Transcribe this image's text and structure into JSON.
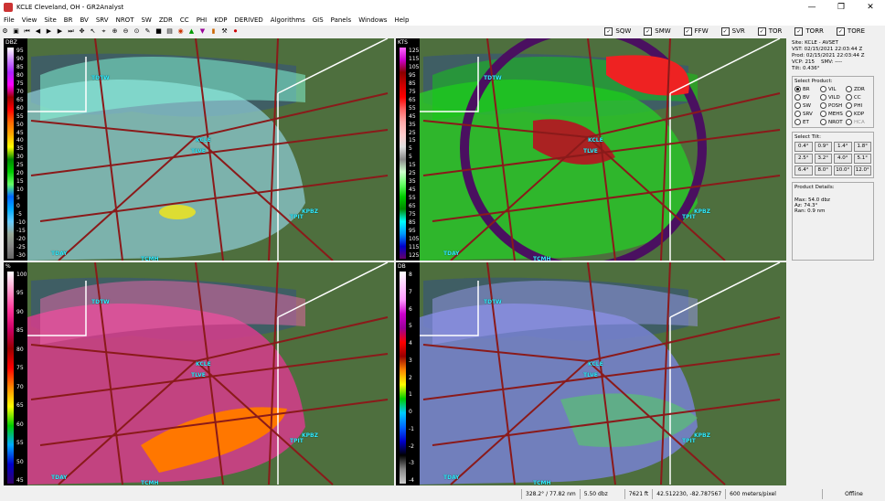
{
  "window": {
    "title": "KCLE Cleveland, OH - GR2Analyst"
  },
  "menu": [
    "File",
    "View",
    "Site",
    "BR",
    "BV",
    "SRV",
    "NROT",
    "SW",
    "ZDR",
    "CC",
    "PHI",
    "KDP",
    "DERIVED",
    "Algorithms",
    "GIS",
    "Panels",
    "Windows",
    "Help"
  ],
  "warnings": [
    {
      "label": "SQW"
    },
    {
      "label": "SMW"
    },
    {
      "label": "FFW"
    },
    {
      "label": "SVR"
    },
    {
      "label": "TOR"
    },
    {
      "label": "TORR"
    },
    {
      "label": "TORE"
    }
  ],
  "panels": [
    {
      "unit": "DBZ",
      "ticks": [
        "95",
        "90",
        "85",
        "80",
        "75",
        "70",
        "65",
        "60",
        "55",
        "50",
        "45",
        "40",
        "35",
        "30",
        "25",
        "20",
        "15",
        "10",
        "5",
        "0",
        "-5",
        "-10",
        "-15",
        "-20",
        "-25",
        "-30"
      ],
      "colors": [
        "#fff",
        "#c8f",
        "#a2f",
        "#f0f",
        "#900",
        "#f00",
        "#f60",
        "#fa0",
        "#ff0",
        "#080",
        "#0c0",
        "#6f6",
        "#06f",
        "#0af",
        "#6cf",
        "#9a9",
        "#888",
        "#666"
      ]
    },
    {
      "unit": "KTS",
      "ticks": [
        "125",
        "115",
        "105",
        "95",
        "85",
        "75",
        "65",
        "55",
        "45",
        "35",
        "25",
        "15",
        "5",
        "5",
        "15",
        "25",
        "35",
        "45",
        "55",
        "65",
        "75",
        "85",
        "95",
        "105",
        "115",
        "125"
      ],
      "colors": [
        "#f6f",
        "#c0c",
        "#800",
        "#c00",
        "#f00",
        "#f66",
        "#faa",
        "#fcc",
        "#ddd",
        "#888",
        "#cfc",
        "#6f6",
        "#0c0",
        "#080",
        "#0ff",
        "#09f",
        "#00c",
        "#606"
      ]
    },
    {
      "unit": "%",
      "ticks": [
        "100",
        "95",
        "90",
        "85",
        "80",
        "75",
        "70",
        "65",
        "60",
        "55",
        "50",
        "45"
      ],
      "colors": [
        "#fff",
        "#f9c",
        "#f39",
        "#c06",
        "#900",
        "#f00",
        "#f80",
        "#ff0",
        "#0c0",
        "#0af",
        "#00c",
        "#306"
      ]
    },
    {
      "unit": "DB",
      "ticks": [
        "8",
        "7",
        "6",
        "5",
        "4",
        "3",
        "2",
        "1",
        "0",
        "-1",
        "-2",
        "-3",
        "-4"
      ],
      "colors": [
        "#fff",
        "#fcf",
        "#f9f",
        "#c0c",
        "#909",
        "#f00",
        "#900",
        "#f80",
        "#ff0",
        "#0c0",
        "#0cf",
        "#06f",
        "#00c",
        "#000",
        "#888",
        "#ccc"
      ]
    }
  ],
  "cities": [
    "TDTW",
    "KCLE",
    "TLVE",
    "TPIT",
    "KPBZ",
    "TDAY",
    "TCMH"
  ],
  "side": {
    "site": "Site:",
    "site_val": "KCLE - AVSET",
    "vst": "VST:",
    "vst_val": "02/15/2021  22:03:44 Z",
    "prod": "Prod:",
    "prod_val": "02/15/2021  22:03:44 Z",
    "vcp": "VCP:",
    "vcp_val": "215",
    "smv": "SMV:",
    "smv_val": "----",
    "tilt": "Tilt:",
    "tilt_val": "0.436°",
    "select_product": "Select Product:",
    "products": [
      "BR",
      "VIL",
      "ZDR",
      "BV",
      "VILD",
      "CC",
      "SW",
      "POSH",
      "PHI",
      "SRV",
      "MEHS",
      "KDP",
      "ET",
      "NROT",
      "HCA"
    ],
    "select_tilt": "Select Tilt:",
    "tilts": [
      "0.4°",
      "0.9°",
      "1.4°",
      "1.8°",
      "2.5°",
      "3.2°",
      "4.0°",
      "5.1°",
      "6.4°",
      "8.0°",
      "10.0°",
      "12.0°"
    ],
    "product_details": "Product Details:",
    "max": "Max:  54.0 dbz",
    "az": "Az:  74.3°",
    "ran": "Ran:  0.9 nm"
  },
  "status": {
    "cursor": "328.2° / 77.82 nm",
    "value": "5.50 dbz",
    "height": "7621 ft",
    "latlon": "42.512230, -82.787567",
    "scale": "600 meters/pixel",
    "state": "Offline"
  }
}
